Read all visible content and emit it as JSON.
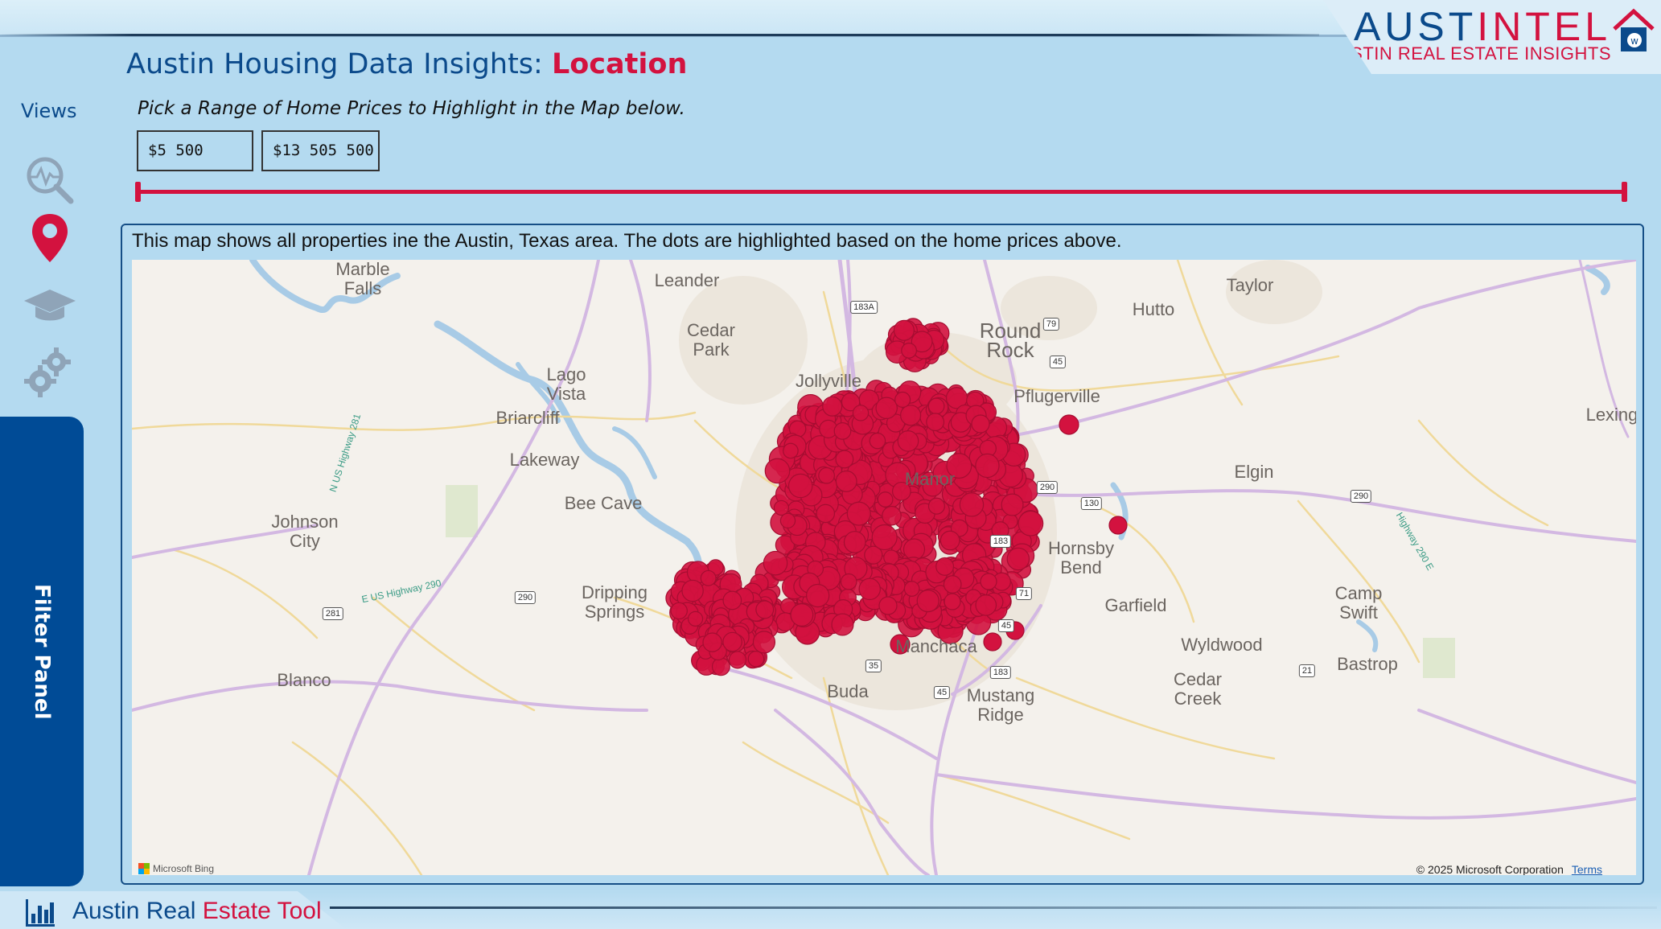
{
  "header": {
    "title_prefix": "Austin Housing Data Insights: ",
    "title_accent": "Location",
    "logo_part1": "AUST",
    "logo_part2": "INTEL",
    "logo_subtitle": "AUSTIN REAL ESTATE INSIGHTS"
  },
  "sidebar": {
    "views_label": "Views",
    "icons": [
      "analytics-icon",
      "location-pin-icon",
      "graduation-cap-icon",
      "settings-gears-icon"
    ],
    "filter_panel_label": "Filter Panel"
  },
  "slicer": {
    "label": "Pick a Range of Home Prices to Highlight in the Map below.",
    "min_value": "$5 500",
    "max_value": "$13 505 500"
  },
  "map": {
    "caption": "This map shows all properties ine the Austin, Texas area. The dots are highlighted based on the home prices above.",
    "places": [
      "Marble Falls",
      "Leander",
      "Taylor",
      "Hutto",
      "Cedar Park",
      "Round Rock",
      "Lago Vista",
      "Jollyville",
      "Pflugerville",
      "Briarcliff",
      "Lexing",
      "Lakeway",
      "Manor",
      "Elgin",
      "Bee Cave",
      "Johnson City",
      "Hornsby Bend",
      "Dripping Springs",
      "Garfield",
      "Camp Swift",
      "Wyldwood",
      "Manchaca",
      "Bastrop",
      "Blanco",
      "Buda",
      "Cedar Creek",
      "Mustang Ridge"
    ],
    "highways": [
      "183A",
      "79",
      "45",
      "290",
      "130",
      "183",
      "71",
      "290",
      "281",
      "35",
      "183",
      "45",
      "21",
      "290",
      "45"
    ],
    "road_labels": [
      "N US Highway 281",
      "E US Highway 290",
      "Highway 290 E"
    ],
    "attribution": "Microsoft Bing",
    "copyright": "© 2025 Microsoft Corporation",
    "terms_label": "Terms",
    "dot_color": "#d3123f"
  },
  "footer": {
    "text_prefix": "Austin Real ",
    "text_accent": "Estate Tool"
  },
  "colors": {
    "background": "#b4daf0",
    "brand_blue": "#0b4a8b",
    "brand_red": "#d3123f",
    "filter_panel": "#004b96"
  }
}
